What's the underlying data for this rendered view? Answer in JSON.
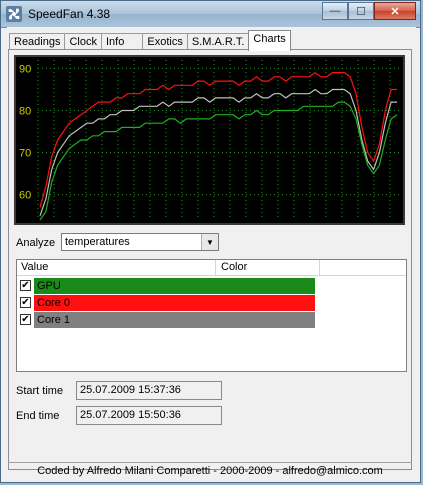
{
  "window": {
    "title": "SpeedFan 4.38",
    "buttons": {
      "minimize": "—",
      "maximize": "☐",
      "close": "✕"
    }
  },
  "tabs": [
    {
      "label": "Readings"
    },
    {
      "label": "Clock"
    },
    {
      "label": "Info"
    },
    {
      "label": "Exotics"
    },
    {
      "label": "S.M.A.R.T."
    },
    {
      "label": "Charts",
      "active": true
    }
  ],
  "chart_data": {
    "type": "line",
    "title": "",
    "xlabel": "",
    "ylabel": "",
    "ylim": [
      54,
      92
    ],
    "yticks": [
      60,
      70,
      80,
      90
    ],
    "grid": true,
    "background": "#000000",
    "tick_color": "#c8c800",
    "x_range": [
      "25.07.2009 15:37:36",
      "25.07.2009 15:50:36"
    ],
    "series": [
      {
        "name": "Core 0",
        "color": "#ff1010",
        "values": [
          57,
          62,
          69,
          73,
          75,
          77,
          78,
          79,
          80,
          81,
          82,
          82,
          82,
          83,
          83,
          84,
          84,
          84,
          85,
          85,
          85,
          86,
          85,
          86,
          86,
          86,
          86,
          87,
          87,
          86,
          87,
          87,
          87,
          87,
          86,
          87,
          87,
          88,
          87,
          87,
          88,
          88,
          87,
          88,
          88,
          88,
          88,
          89,
          88,
          88,
          89,
          89,
          89,
          88,
          84,
          76,
          70,
          68,
          72,
          80,
          85,
          85
        ]
      },
      {
        "name": "Core 1",
        "color": "#c0c0c0",
        "values": [
          55,
          59,
          66,
          70,
          72,
          74,
          75,
          76,
          77,
          77,
          78,
          78,
          79,
          79,
          80,
          80,
          80,
          81,
          81,
          81,
          81,
          82,
          81,
          82,
          82,
          82,
          82,
          83,
          83,
          82,
          83,
          83,
          83,
          83,
          82,
          83,
          83,
          84,
          83,
          83,
          84,
          84,
          83,
          84,
          84,
          84,
          84,
          85,
          84,
          84,
          85,
          85,
          85,
          84,
          80,
          73,
          68,
          66,
          70,
          77,
          82,
          82
        ]
      },
      {
        "name": "GPU",
        "color": "#1fb01f",
        "values": [
          54,
          56,
          63,
          67,
          69,
          71,
          72,
          73,
          73,
          74,
          74,
          75,
          75,
          75,
          76,
          76,
          76,
          76,
          77,
          77,
          77,
          77,
          78,
          78,
          77,
          78,
          78,
          78,
          78,
          78,
          79,
          79,
          79,
          79,
          78,
          79,
          79,
          80,
          79,
          79,
          80,
          80,
          80,
          80,
          80,
          81,
          81,
          81,
          81,
          81,
          81,
          82,
          82,
          81,
          78,
          72,
          67,
          65,
          67,
          73,
          78,
          79
        ]
      }
    ]
  },
  "analyze": {
    "label": "Analyze",
    "value": "temperatures"
  },
  "list": {
    "columns": [
      "Value",
      "Color"
    ],
    "rows": [
      {
        "label": "GPU",
        "checked": true,
        "color": "#1a8a1a"
      },
      {
        "label": "Core 0",
        "checked": true,
        "color": "#ff1010"
      },
      {
        "label": "Core 1",
        "checked": true,
        "color": "#808080"
      }
    ]
  },
  "times": {
    "start_label": "Start time",
    "start_value": "25.07.2009 15:37:36",
    "end_label": "End time",
    "end_value": "25.07.2009 15:50:36"
  },
  "status": "Coded by Alfredo Milani Comparetti - 2000-2009 - alfredo@almico.com"
}
